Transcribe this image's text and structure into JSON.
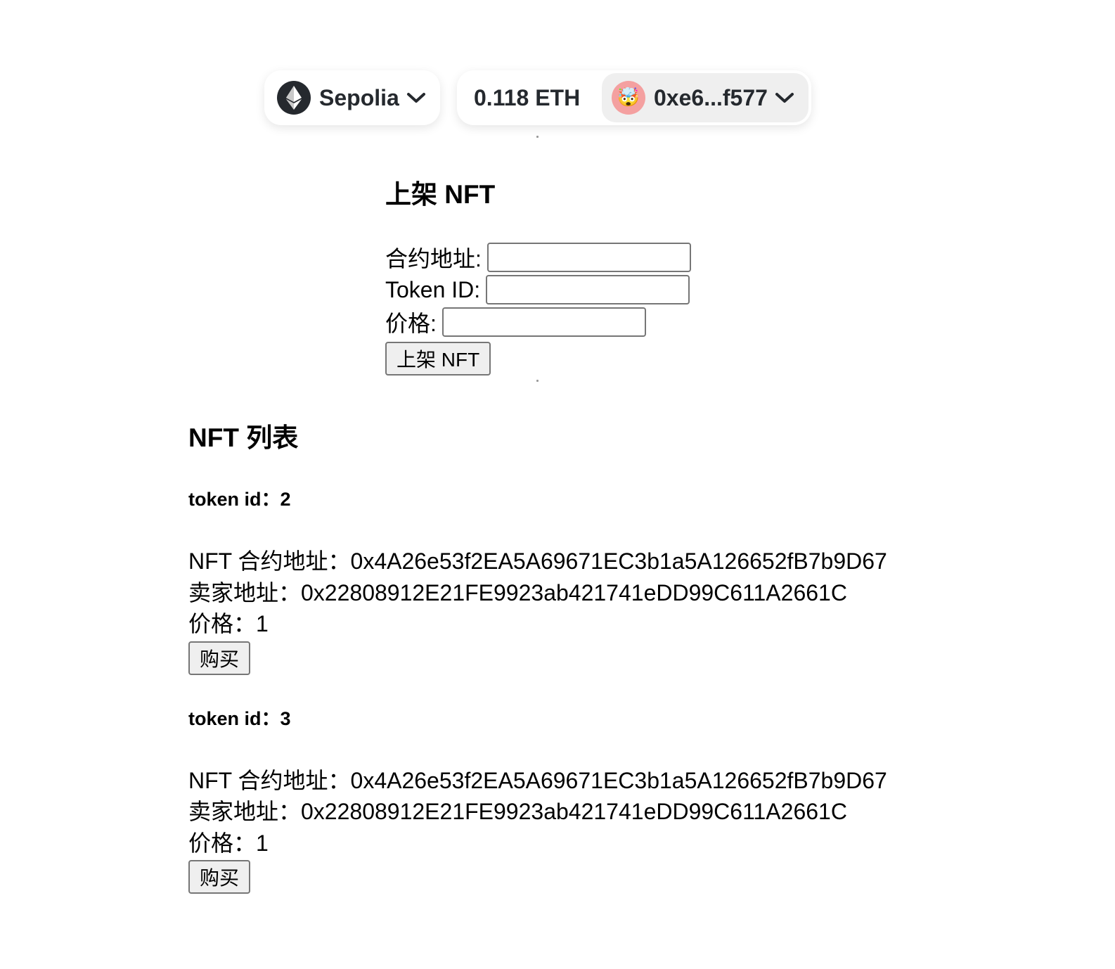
{
  "wallet": {
    "chain_name": "Sepolia",
    "balance": "0.118 ETH",
    "account": "0xe6...f577",
    "avatar_emoji": "🤯"
  },
  "list_form": {
    "title": "上架 NFT",
    "contract_label": "合约地址:",
    "token_id_label": "Token ID:",
    "price_label": "价格:",
    "submit_label": "上架 NFT"
  },
  "nft_list": {
    "title": "NFT 列表",
    "items": [
      {
        "token_id_line": "token id：2",
        "contract_line": "NFT 合约地址：0x4A26e53f2EA5A69671EC3b1a5A126652fB7b9D67",
        "seller_line": "卖家地址：0x22808912E21FE9923ab421741eDD99C611A2661C",
        "price_line": "价格：1",
        "buy_label": "购买"
      },
      {
        "token_id_line": "token id：3",
        "contract_line": "NFT 合约地址：0x4A26e53f2EA5A69671EC3b1a5A126652fB7b9D67",
        "seller_line": "卖家地址：0x22808912E21FE9923ab421741eDD99C611A2661C",
        "price_line": "价格：1",
        "buy_label": "购买"
      }
    ]
  }
}
